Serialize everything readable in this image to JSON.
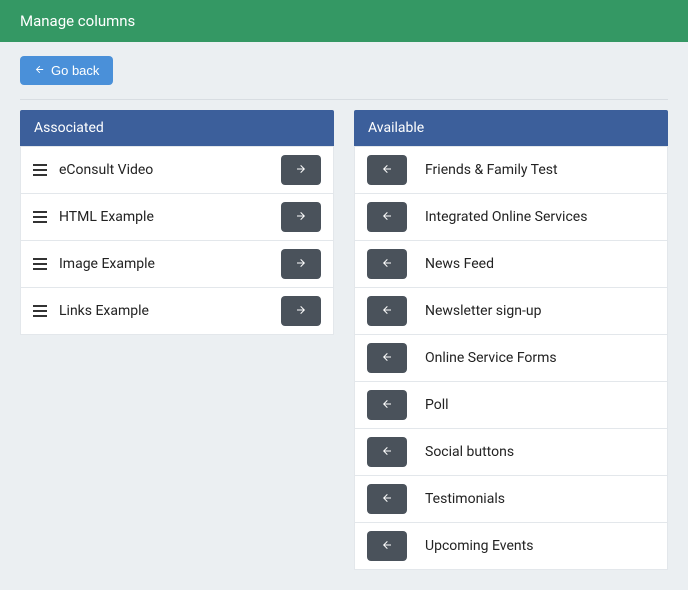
{
  "header": {
    "title": "Manage columns"
  },
  "toolbar": {
    "back_label": "Go back"
  },
  "panels": {
    "associated": {
      "title": "Associated",
      "items": [
        {
          "label": "eConsult Video"
        },
        {
          "label": "HTML Example"
        },
        {
          "label": "Image Example"
        },
        {
          "label": "Links Example"
        }
      ]
    },
    "available": {
      "title": "Available",
      "items": [
        {
          "label": "Friends & Family Test"
        },
        {
          "label": "Integrated Online Services"
        },
        {
          "label": "News Feed"
        },
        {
          "label": "Newsletter sign-up"
        },
        {
          "label": "Online Service Forms"
        },
        {
          "label": "Poll"
        },
        {
          "label": "Social buttons"
        },
        {
          "label": "Testimonials"
        },
        {
          "label": "Upcoming Events"
        }
      ]
    }
  }
}
